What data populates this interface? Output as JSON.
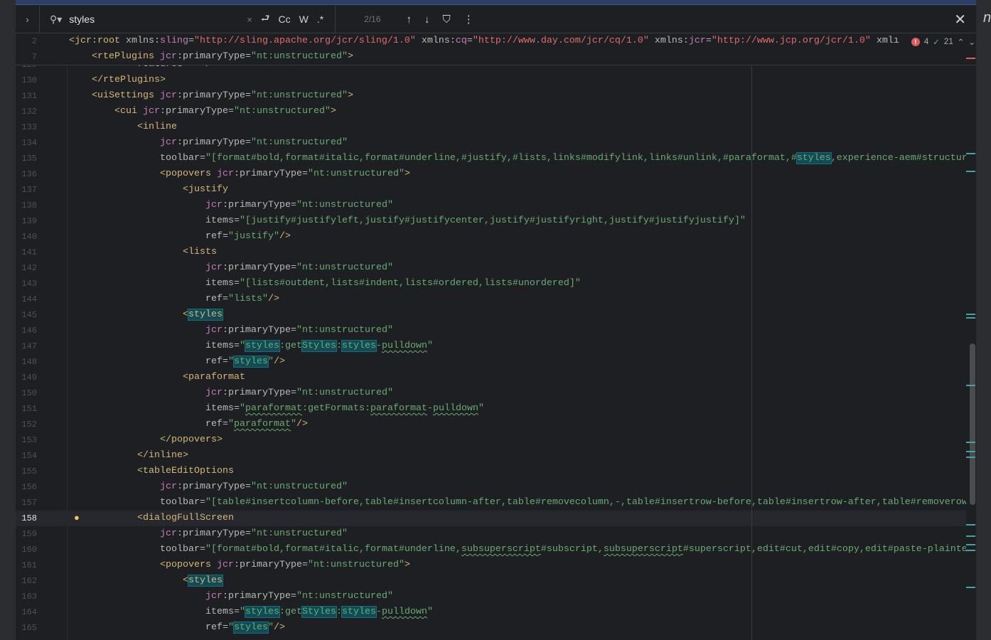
{
  "search": {
    "query": "styles",
    "match_count": "2/16",
    "case_label": "Cc",
    "words_label": "W",
    "regex_label": ".*"
  },
  "status": {
    "errors": "4",
    "ok": "21"
  },
  "right_panel_letter": "n",
  "colors": {
    "tag": "#d5b778",
    "attr": "#bababa",
    "namespace": "#c77dbb",
    "string": "#6aab73",
    "match_bg": "#114b56",
    "accent": "#3d5a94"
  },
  "sticky_lines": [
    {
      "n": "2",
      "indent": 0,
      "tokens": [
        [
          "t",
          "<jcr:root "
        ],
        [
          "a",
          "xmlns:"
        ],
        [
          "n",
          "sling"
        ],
        [
          "a",
          "="
        ],
        [
          "r",
          "\"http://sling.apache.org/jcr/sling/1.0\""
        ],
        [
          "a",
          " xmlns:"
        ],
        [
          "n",
          "cq"
        ],
        [
          "a",
          "="
        ],
        [
          "r",
          "\"http://www.day.com/jcr/cq/1.0\""
        ],
        [
          "a",
          " xmlns:"
        ],
        [
          "n",
          "jcr"
        ],
        [
          "a",
          "="
        ],
        [
          "r",
          "\"http://www.jcp.org/jcr/1.0\""
        ],
        [
          "a",
          " xmlı"
        ]
      ]
    },
    {
      "n": "7",
      "indent": 1,
      "tokens": [
        [
          "t",
          "<rtePlugins "
        ],
        [
          "n",
          "jcr"
        ],
        [
          "a",
          ":primaryType="
        ],
        [
          "s",
          "\"nt:unstructured\""
        ],
        [
          "t",
          ">"
        ]
      ]
    }
  ],
  "lines": [
    {
      "n": "129",
      "indent": 3,
      "tokens": [
        [
          "a",
          "features="
        ],
        [
          "s",
          "\"*\""
        ],
        [
          "t",
          "/>"
        ]
      ]
    },
    {
      "n": "130",
      "indent": 1,
      "tokens": [
        [
          "t",
          "</rtePlugins>"
        ]
      ]
    },
    {
      "n": "131",
      "indent": 1,
      "tokens": [
        [
          "t",
          "<uiSettings "
        ],
        [
          "n",
          "jcr"
        ],
        [
          "a",
          ":primaryType="
        ],
        [
          "s",
          "\"nt:unstructured\""
        ],
        [
          "t",
          ">"
        ]
      ]
    },
    {
      "n": "132",
      "indent": 2,
      "tokens": [
        [
          "t",
          "<cui "
        ],
        [
          "n",
          "jcr"
        ],
        [
          "a",
          ":primaryType="
        ],
        [
          "s",
          "\"nt:unstructured\""
        ],
        [
          "t",
          ">"
        ]
      ]
    },
    {
      "n": "133",
      "indent": 3,
      "tokens": [
        [
          "t",
          "<inline"
        ]
      ]
    },
    {
      "n": "134",
      "indent": 4,
      "tokens": [
        [
          "n",
          "jcr"
        ],
        [
          "a",
          ":primaryType="
        ],
        [
          "s",
          "\"nt:unstructured\""
        ]
      ]
    },
    {
      "n": "135",
      "indent": 4,
      "tokens": [
        [
          "a",
          "toolbar="
        ],
        [
          "s",
          "\"[format#bold,format#italic,format#underline,#justify,#lists,links#modifylink,links#unlink,#paraformat,#"
        ],
        [
          "sm",
          "styles"
        ],
        [
          "s",
          ",experience-aem#structured"
        ]
      ]
    },
    {
      "n": "136",
      "indent": 4,
      "tokens": [
        [
          "t",
          "<popovers "
        ],
        [
          "n",
          "jcr"
        ],
        [
          "a",
          ":primaryType="
        ],
        [
          "s",
          "\"nt:unstructured\""
        ],
        [
          "t",
          ">"
        ]
      ]
    },
    {
      "n": "137",
      "indent": 5,
      "tokens": [
        [
          "t",
          "<justify"
        ]
      ]
    },
    {
      "n": "138",
      "indent": 6,
      "tokens": [
        [
          "n",
          "jcr"
        ],
        [
          "a",
          ":primaryType="
        ],
        [
          "s",
          "\"nt:unstructured\""
        ]
      ]
    },
    {
      "n": "139",
      "indent": 6,
      "tokens": [
        [
          "a",
          "items="
        ],
        [
          "s",
          "\"[justify#justifyleft,justify#justifycenter,justify#justifyright,justify#justifyjustify]\""
        ]
      ]
    },
    {
      "n": "140",
      "indent": 6,
      "tokens": [
        [
          "a",
          "ref="
        ],
        [
          "s",
          "\"justify\""
        ],
        [
          "t",
          "/>"
        ]
      ]
    },
    {
      "n": "141",
      "indent": 5,
      "tokens": [
        [
          "t",
          "<lists"
        ]
      ]
    },
    {
      "n": "142",
      "indent": 6,
      "tokens": [
        [
          "n",
          "jcr"
        ],
        [
          "a",
          ":primaryType="
        ],
        [
          "s",
          "\"nt:unstructured\""
        ]
      ]
    },
    {
      "n": "143",
      "indent": 6,
      "tokens": [
        [
          "a",
          "items="
        ],
        [
          "s",
          "\"[lists#outdent,lists#indent,lists#ordered,lists#unordered]\""
        ]
      ]
    },
    {
      "n": "144",
      "indent": 6,
      "tokens": [
        [
          "a",
          "ref="
        ],
        [
          "s",
          "\"lists\""
        ],
        [
          "t",
          "/>"
        ]
      ]
    },
    {
      "n": "145",
      "indent": 5,
      "tokens": [
        [
          "t",
          "<"
        ],
        [
          "tm",
          "styles"
        ]
      ]
    },
    {
      "n": "146",
      "indent": 6,
      "tokens": [
        [
          "n",
          "jcr"
        ],
        [
          "a",
          ":primaryType="
        ],
        [
          "s",
          "\"nt:unstructured\""
        ]
      ]
    },
    {
      "n": "147",
      "indent": 6,
      "tokens": [
        [
          "a",
          "items="
        ],
        [
          "s",
          "\""
        ],
        [
          "sm",
          "styles"
        ],
        [
          "s",
          ":get"
        ],
        [
          "sm",
          "Styles"
        ],
        [
          "s",
          ":"
        ],
        [
          "sm",
          "styles"
        ],
        [
          "s",
          "-"
        ],
        [
          "sw",
          "pulldown"
        ],
        [
          "s",
          "\""
        ]
      ]
    },
    {
      "n": "148",
      "indent": 6,
      "tokens": [
        [
          "a",
          "ref="
        ],
        [
          "s",
          "\""
        ],
        [
          "sm",
          "styles"
        ],
        [
          "s",
          "\""
        ],
        [
          "t",
          "/>"
        ]
      ]
    },
    {
      "n": "149",
      "indent": 5,
      "tokens": [
        [
          "t",
          "<paraformat"
        ]
      ]
    },
    {
      "n": "150",
      "indent": 6,
      "tokens": [
        [
          "n",
          "jcr"
        ],
        [
          "a",
          ":primaryType="
        ],
        [
          "s",
          "\"nt:unstructured\""
        ]
      ]
    },
    {
      "n": "151",
      "indent": 6,
      "tokens": [
        [
          "a",
          "items="
        ],
        [
          "s",
          "\""
        ],
        [
          "sw",
          "paraformat"
        ],
        [
          "s",
          ":getFormats:"
        ],
        [
          "sw",
          "paraformat"
        ],
        [
          "s",
          "-"
        ],
        [
          "sw",
          "pulldown"
        ],
        [
          "s",
          "\""
        ]
      ]
    },
    {
      "n": "152",
      "indent": 6,
      "tokens": [
        [
          "a",
          "ref="
        ],
        [
          "s",
          "\""
        ],
        [
          "sw",
          "paraformat"
        ],
        [
          "s",
          "\""
        ],
        [
          "t",
          "/>"
        ]
      ]
    },
    {
      "n": "153",
      "indent": 4,
      "tokens": [
        [
          "t",
          "</popovers>"
        ]
      ]
    },
    {
      "n": "154",
      "indent": 3,
      "tokens": [
        [
          "t",
          "</inline>"
        ]
      ]
    },
    {
      "n": "155",
      "indent": 3,
      "tokens": [
        [
          "t",
          "<tableEditOptions"
        ]
      ]
    },
    {
      "n": "156",
      "indent": 4,
      "tokens": [
        [
          "n",
          "jcr"
        ],
        [
          "a",
          ":primaryType="
        ],
        [
          "s",
          "\"nt:unstructured\""
        ]
      ]
    },
    {
      "n": "157",
      "indent": 4,
      "tokens": [
        [
          "a",
          "toolbar="
        ],
        [
          "s",
          "\"[table#insertcolumn-before,table#insertcolumn-after,table#removecolumn,-,table#insertrow-before,table#insertrow-after,table#removerow,-"
        ]
      ]
    },
    {
      "n": "158",
      "indent": 3,
      "current": true,
      "tokens": [
        [
          "t",
          "<dialogFullScreen"
        ]
      ]
    },
    {
      "n": "159",
      "indent": 4,
      "tokens": [
        [
          "n",
          "jcr"
        ],
        [
          "a",
          ":primaryType="
        ],
        [
          "s",
          "\"nt:unstructured\""
        ]
      ]
    },
    {
      "n": "160",
      "indent": 4,
      "tokens": [
        [
          "a",
          "toolbar="
        ],
        [
          "s",
          "\"[format#bold,format#italic,format#underline,"
        ],
        [
          "sw",
          "subsuperscript"
        ],
        [
          "s",
          "#subscript,"
        ],
        [
          "sw",
          "subsuperscript"
        ],
        [
          "s",
          "#superscript,edit#cut,edit#copy,edit#paste-plaintext"
        ]
      ]
    },
    {
      "n": "161",
      "indent": 4,
      "tokens": [
        [
          "t",
          "<popovers "
        ],
        [
          "n",
          "jcr"
        ],
        [
          "a",
          ":primaryType="
        ],
        [
          "s",
          "\"nt:unstructured\""
        ],
        [
          "t",
          ">"
        ]
      ]
    },
    {
      "n": "162",
      "indent": 5,
      "tokens": [
        [
          "t",
          "<"
        ],
        [
          "tm",
          "styles"
        ]
      ]
    },
    {
      "n": "163",
      "indent": 6,
      "tokens": [
        [
          "n",
          "jcr"
        ],
        [
          "a",
          ":primaryType="
        ],
        [
          "s",
          "\"nt:unstructured\""
        ]
      ]
    },
    {
      "n": "164",
      "indent": 6,
      "tokens": [
        [
          "a",
          "items="
        ],
        [
          "s",
          "\""
        ],
        [
          "sm",
          "styles"
        ],
        [
          "s",
          ":get"
        ],
        [
          "sm",
          "Styles"
        ],
        [
          "s",
          ":"
        ],
        [
          "sm",
          "styles"
        ],
        [
          "s",
          "-"
        ],
        [
          "sw",
          "pulldown"
        ],
        [
          "s",
          "\""
        ]
      ]
    },
    {
      "n": "165",
      "indent": 6,
      "tokens": [
        [
          "a",
          "ref="
        ],
        [
          "s",
          "\""
        ],
        [
          "sm",
          "styles"
        ],
        [
          "s",
          "\""
        ],
        [
          "t",
          "/>"
        ]
      ]
    }
  ]
}
